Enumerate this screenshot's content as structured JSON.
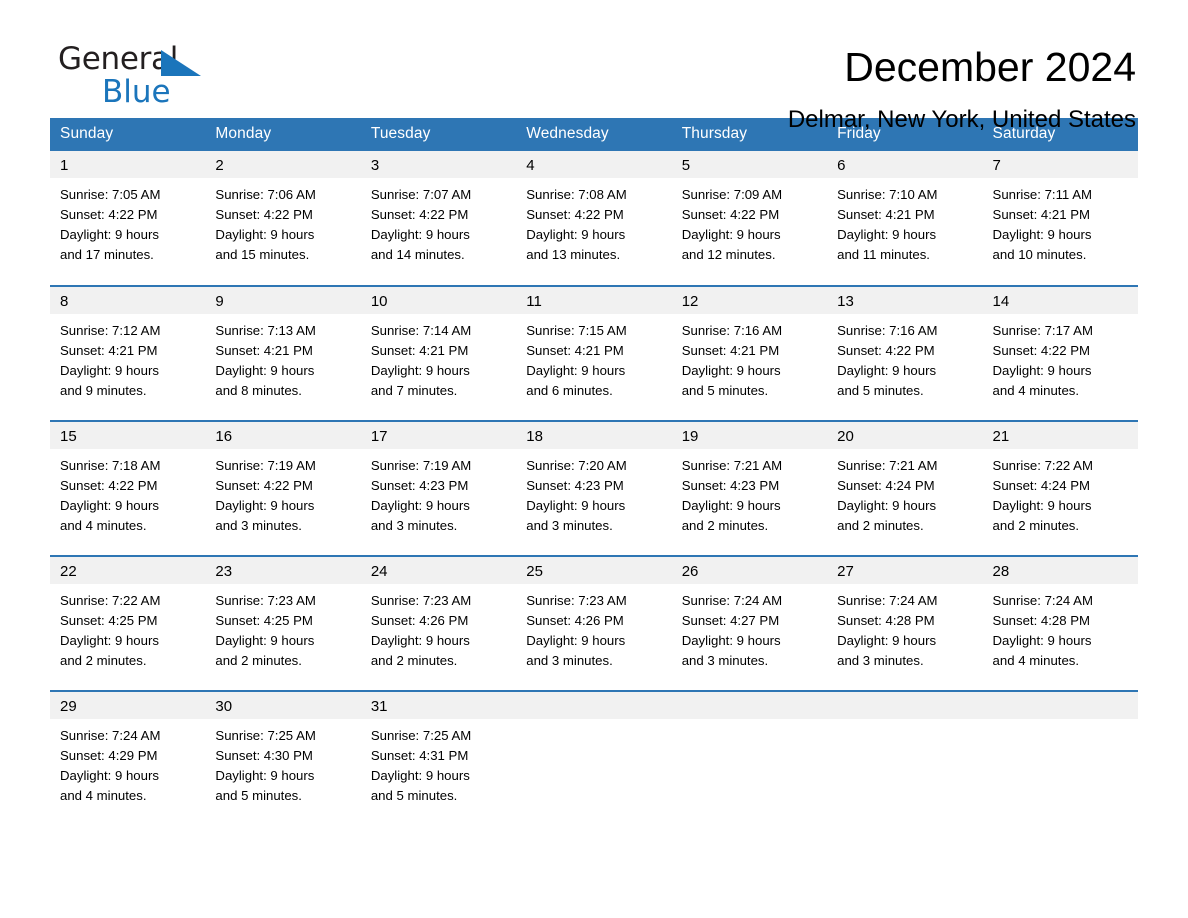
{
  "brand": {
    "name_part1": "General",
    "name_part2": "Blue",
    "accent_color": "#1b75bb"
  },
  "header": {
    "title": "December 2024",
    "subtitle": "Delmar, New York, United States"
  },
  "theme": {
    "header_blue": "#2e76b4",
    "daynum_band": "#f1f1f1"
  },
  "weekdays": [
    "Sunday",
    "Monday",
    "Tuesday",
    "Wednesday",
    "Thursday",
    "Friday",
    "Saturday"
  ],
  "weeks": [
    [
      {
        "day": "1",
        "sunrise": "Sunrise: 7:05 AM",
        "sunset": "Sunset: 4:22 PM",
        "daylight_line1": "Daylight: 9 hours",
        "daylight_line2": "and 17 minutes."
      },
      {
        "day": "2",
        "sunrise": "Sunrise: 7:06 AM",
        "sunset": "Sunset: 4:22 PM",
        "daylight_line1": "Daylight: 9 hours",
        "daylight_line2": "and 15 minutes."
      },
      {
        "day": "3",
        "sunrise": "Sunrise: 7:07 AM",
        "sunset": "Sunset: 4:22 PM",
        "daylight_line1": "Daylight: 9 hours",
        "daylight_line2": "and 14 minutes."
      },
      {
        "day": "4",
        "sunrise": "Sunrise: 7:08 AM",
        "sunset": "Sunset: 4:22 PM",
        "daylight_line1": "Daylight: 9 hours",
        "daylight_line2": "and 13 minutes."
      },
      {
        "day": "5",
        "sunrise": "Sunrise: 7:09 AM",
        "sunset": "Sunset: 4:22 PM",
        "daylight_line1": "Daylight: 9 hours",
        "daylight_line2": "and 12 minutes."
      },
      {
        "day": "6",
        "sunrise": "Sunrise: 7:10 AM",
        "sunset": "Sunset: 4:21 PM",
        "daylight_line1": "Daylight: 9 hours",
        "daylight_line2": "and 11 minutes."
      },
      {
        "day": "7",
        "sunrise": "Sunrise: 7:11 AM",
        "sunset": "Sunset: 4:21 PM",
        "daylight_line1": "Daylight: 9 hours",
        "daylight_line2": "and 10 minutes."
      }
    ],
    [
      {
        "day": "8",
        "sunrise": "Sunrise: 7:12 AM",
        "sunset": "Sunset: 4:21 PM",
        "daylight_line1": "Daylight: 9 hours",
        "daylight_line2": "and 9 minutes."
      },
      {
        "day": "9",
        "sunrise": "Sunrise: 7:13 AM",
        "sunset": "Sunset: 4:21 PM",
        "daylight_line1": "Daylight: 9 hours",
        "daylight_line2": "and 8 minutes."
      },
      {
        "day": "10",
        "sunrise": "Sunrise: 7:14 AM",
        "sunset": "Sunset: 4:21 PM",
        "daylight_line1": "Daylight: 9 hours",
        "daylight_line2": "and 7 minutes."
      },
      {
        "day": "11",
        "sunrise": "Sunrise: 7:15 AM",
        "sunset": "Sunset: 4:21 PM",
        "daylight_line1": "Daylight: 9 hours",
        "daylight_line2": "and 6 minutes."
      },
      {
        "day": "12",
        "sunrise": "Sunrise: 7:16 AM",
        "sunset": "Sunset: 4:21 PM",
        "daylight_line1": "Daylight: 9 hours",
        "daylight_line2": "and 5 minutes."
      },
      {
        "day": "13",
        "sunrise": "Sunrise: 7:16 AM",
        "sunset": "Sunset: 4:22 PM",
        "daylight_line1": "Daylight: 9 hours",
        "daylight_line2": "and 5 minutes."
      },
      {
        "day": "14",
        "sunrise": "Sunrise: 7:17 AM",
        "sunset": "Sunset: 4:22 PM",
        "daylight_line1": "Daylight: 9 hours",
        "daylight_line2": "and 4 minutes."
      }
    ],
    [
      {
        "day": "15",
        "sunrise": "Sunrise: 7:18 AM",
        "sunset": "Sunset: 4:22 PM",
        "daylight_line1": "Daylight: 9 hours",
        "daylight_line2": "and 4 minutes."
      },
      {
        "day": "16",
        "sunrise": "Sunrise: 7:19 AM",
        "sunset": "Sunset: 4:22 PM",
        "daylight_line1": "Daylight: 9 hours",
        "daylight_line2": "and 3 minutes."
      },
      {
        "day": "17",
        "sunrise": "Sunrise: 7:19 AM",
        "sunset": "Sunset: 4:23 PM",
        "daylight_line1": "Daylight: 9 hours",
        "daylight_line2": "and 3 minutes."
      },
      {
        "day": "18",
        "sunrise": "Sunrise: 7:20 AM",
        "sunset": "Sunset: 4:23 PM",
        "daylight_line1": "Daylight: 9 hours",
        "daylight_line2": "and 3 minutes."
      },
      {
        "day": "19",
        "sunrise": "Sunrise: 7:21 AM",
        "sunset": "Sunset: 4:23 PM",
        "daylight_line1": "Daylight: 9 hours",
        "daylight_line2": "and 2 minutes."
      },
      {
        "day": "20",
        "sunrise": "Sunrise: 7:21 AM",
        "sunset": "Sunset: 4:24 PM",
        "daylight_line1": "Daylight: 9 hours",
        "daylight_line2": "and 2 minutes."
      },
      {
        "day": "21",
        "sunrise": "Sunrise: 7:22 AM",
        "sunset": "Sunset: 4:24 PM",
        "daylight_line1": "Daylight: 9 hours",
        "daylight_line2": "and 2 minutes."
      }
    ],
    [
      {
        "day": "22",
        "sunrise": "Sunrise: 7:22 AM",
        "sunset": "Sunset: 4:25 PM",
        "daylight_line1": "Daylight: 9 hours",
        "daylight_line2": "and 2 minutes."
      },
      {
        "day": "23",
        "sunrise": "Sunrise: 7:23 AM",
        "sunset": "Sunset: 4:25 PM",
        "daylight_line1": "Daylight: 9 hours",
        "daylight_line2": "and 2 minutes."
      },
      {
        "day": "24",
        "sunrise": "Sunrise: 7:23 AM",
        "sunset": "Sunset: 4:26 PM",
        "daylight_line1": "Daylight: 9 hours",
        "daylight_line2": "and 2 minutes."
      },
      {
        "day": "25",
        "sunrise": "Sunrise: 7:23 AM",
        "sunset": "Sunset: 4:26 PM",
        "daylight_line1": "Daylight: 9 hours",
        "daylight_line2": "and 3 minutes."
      },
      {
        "day": "26",
        "sunrise": "Sunrise: 7:24 AM",
        "sunset": "Sunset: 4:27 PM",
        "daylight_line1": "Daylight: 9 hours",
        "daylight_line2": "and 3 minutes."
      },
      {
        "day": "27",
        "sunrise": "Sunrise: 7:24 AM",
        "sunset": "Sunset: 4:28 PM",
        "daylight_line1": "Daylight: 9 hours",
        "daylight_line2": "and 3 minutes."
      },
      {
        "day": "28",
        "sunrise": "Sunrise: 7:24 AM",
        "sunset": "Sunset: 4:28 PM",
        "daylight_line1": "Daylight: 9 hours",
        "daylight_line2": "and 4 minutes."
      }
    ],
    [
      {
        "day": "29",
        "sunrise": "Sunrise: 7:24 AM",
        "sunset": "Sunset: 4:29 PM",
        "daylight_line1": "Daylight: 9 hours",
        "daylight_line2": "and 4 minutes."
      },
      {
        "day": "30",
        "sunrise": "Sunrise: 7:25 AM",
        "sunset": "Sunset: 4:30 PM",
        "daylight_line1": "Daylight: 9 hours",
        "daylight_line2": "and 5 minutes."
      },
      {
        "day": "31",
        "sunrise": "Sunrise: 7:25 AM",
        "sunset": "Sunset: 4:31 PM",
        "daylight_line1": "Daylight: 9 hours",
        "daylight_line2": "and 5 minutes."
      },
      {
        "day": "",
        "sunrise": "",
        "sunset": "",
        "daylight_line1": "",
        "daylight_line2": ""
      },
      {
        "day": "",
        "sunrise": "",
        "sunset": "",
        "daylight_line1": "",
        "daylight_line2": ""
      },
      {
        "day": "",
        "sunrise": "",
        "sunset": "",
        "daylight_line1": "",
        "daylight_line2": ""
      },
      {
        "day": "",
        "sunrise": "",
        "sunset": "",
        "daylight_line1": "",
        "daylight_line2": ""
      }
    ]
  ]
}
